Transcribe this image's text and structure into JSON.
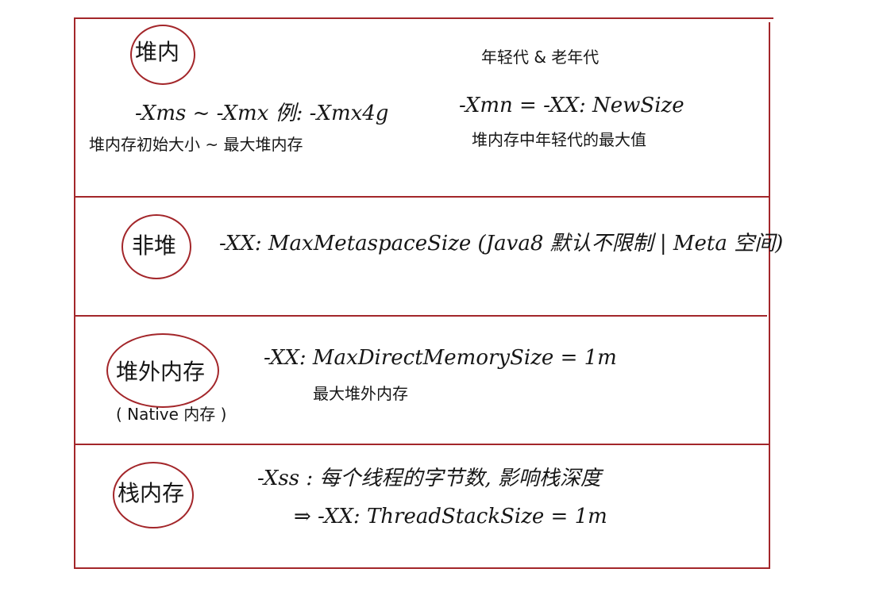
{
  "sections": {
    "heap": {
      "label": "堆内",
      "line1": "-Xms ~ -Xmx  例: -Xmx4g",
      "line2": "堆内存初始大小 ~ 最大堆内存",
      "young_title": "年轻代 & 老年代",
      "young_flag": "-Xmn = -XX: NewSize",
      "young_desc": "堆内存中年轻代的最大值"
    },
    "non_heap": {
      "label": "非堆",
      "flag": "-XX: MaxMetaspaceSize (Java8 默认不限制 | Meta 空间)"
    },
    "off_heap": {
      "label": "堆外内存",
      "sublabel": "( Native 内存 )",
      "flag": "-XX: MaxDirectMemorySize = 1m",
      "desc": "最大堆外内存"
    },
    "stack": {
      "label": "栈内存",
      "line1": "-Xss : 每个线程的字节数, 影响栈深度",
      "line2": "⇒ -XX: ThreadStackSize = 1m"
    }
  },
  "colors": {
    "ink": "#161616",
    "border": "#a3262a"
  }
}
